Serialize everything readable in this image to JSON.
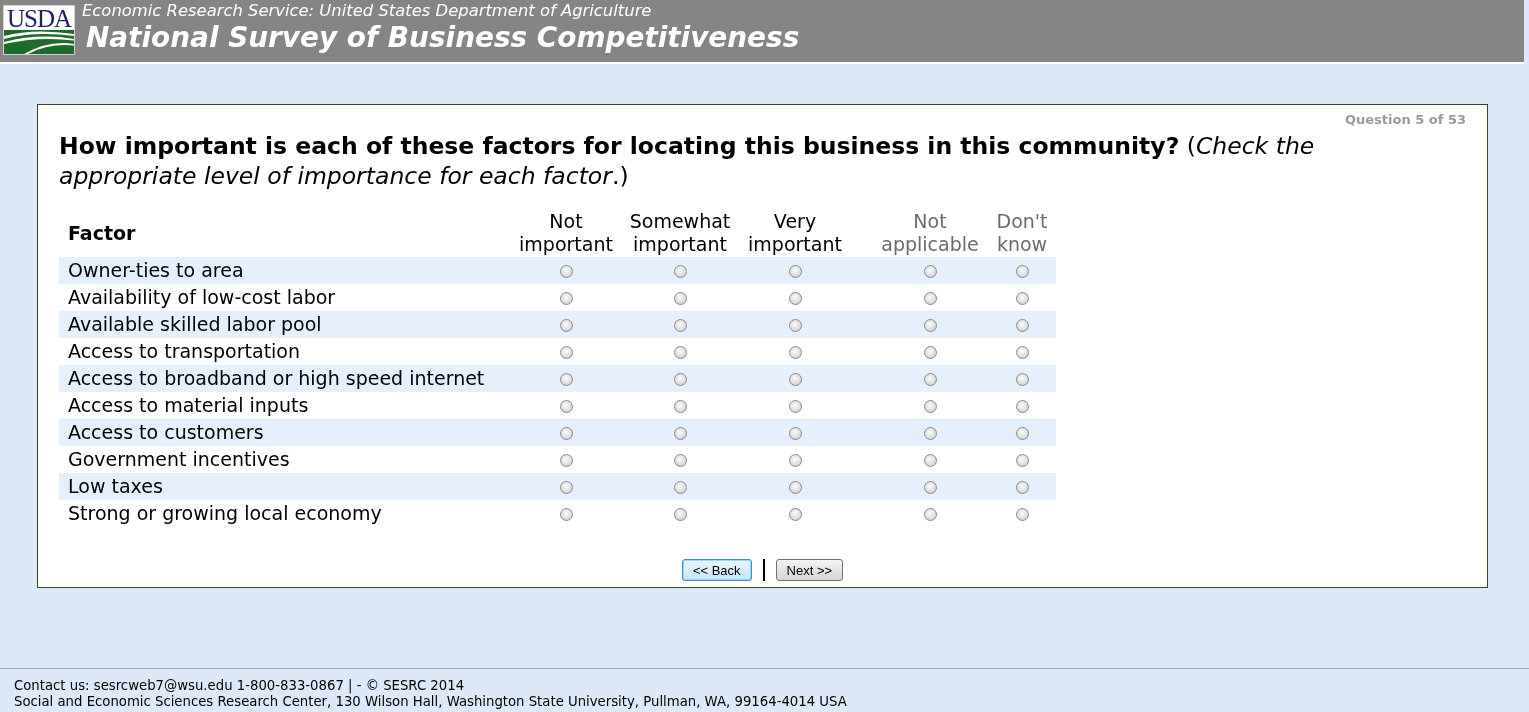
{
  "header": {
    "logo": "USDA",
    "subtitle": "Economic Research Service: United States Department of Agriculture",
    "title": "National Survey of Business Competitiveness"
  },
  "question": {
    "counter": "Question 5 of 53",
    "text": "**How important is each of these factors for locating this business in this community?** (*Check the appropriate level of importance for each factor*.)"
  },
  "table": {
    "factor_header": "Factor",
    "columns": [
      {
        "label": "Not important",
        "dimmed": false
      },
      {
        "label": "Somewhat important",
        "dimmed": false
      },
      {
        "label": "Very important",
        "dimmed": false
      },
      {
        "label": "Not applicable",
        "dimmed": true
      },
      {
        "label": "Don't know",
        "dimmed": true
      }
    ],
    "rows": [
      {
        "label": "Owner-ties to area",
        "options": [
          {
            "selected": false
          },
          {
            "selected": false
          },
          {
            "selected": false
          },
          {
            "selected": false
          },
          {
            "selected": false
          }
        ]
      },
      {
        "label": "Availability of low-cost labor",
        "options": [
          {
            "selected": false
          },
          {
            "selected": false
          },
          {
            "selected": false
          },
          {
            "selected": false
          },
          {
            "selected": false
          }
        ]
      },
      {
        "label": "Available skilled labor pool",
        "options": [
          {
            "selected": false
          },
          {
            "selected": false
          },
          {
            "selected": false
          },
          {
            "selected": false
          },
          {
            "selected": false
          }
        ]
      },
      {
        "label": "Access to transportation",
        "options": [
          {
            "selected": false
          },
          {
            "selected": false
          },
          {
            "selected": false
          },
          {
            "selected": false
          },
          {
            "selected": false
          }
        ]
      },
      {
        "label": "Access to broadband or high speed internet",
        "options": [
          {
            "selected": false
          },
          {
            "selected": false
          },
          {
            "selected": false
          },
          {
            "selected": false
          },
          {
            "selected": false
          }
        ]
      },
      {
        "label": "Access to material inputs",
        "options": [
          {
            "selected": false
          },
          {
            "selected": false
          },
          {
            "selected": false
          },
          {
            "selected": false
          },
          {
            "selected": false
          }
        ]
      },
      {
        "label": "Access to customers",
        "options": [
          {
            "selected": false
          },
          {
            "selected": false
          },
          {
            "selected": false
          },
          {
            "selected": false
          },
          {
            "selected": false
          }
        ]
      },
      {
        "label": "Government incentives",
        "options": [
          {
            "selected": false
          },
          {
            "selected": false
          },
          {
            "selected": false
          },
          {
            "selected": false
          },
          {
            "selected": false
          }
        ]
      },
      {
        "label": "Low taxes",
        "options": [
          {
            "selected": false
          },
          {
            "selected": false
          },
          {
            "selected": false
          },
          {
            "selected": false
          },
          {
            "selected": false
          }
        ]
      },
      {
        "label": "Strong or growing local economy",
        "options": [
          {
            "selected": false
          },
          {
            "selected": false
          },
          {
            "selected": false
          },
          {
            "selected": false
          },
          {
            "selected": false
          }
        ]
      }
    ]
  },
  "nav": {
    "buttons": [
      {
        "label": "<< Back",
        "focused": true
      },
      {
        "label": "Next >>",
        "focused": false
      }
    ]
  },
  "footer": {
    "contact": "Contact us: sesrcweb7@wsu.edu 1-800-833-0867 | - © SESRC 2014",
    "address": "Social and Economic Sciences Research Center, 130 Wilson Hall, Washington State University, Pullman, WA, 99164-4014 USA"
  }
}
